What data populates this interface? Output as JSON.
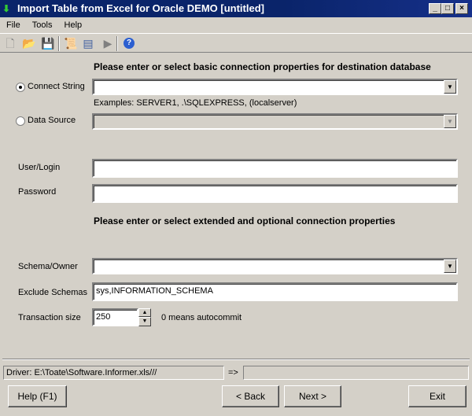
{
  "window": {
    "title": "Import Table from Excel for Oracle DEMO [untitled]"
  },
  "menu": [
    "File",
    "Tools",
    "Help"
  ],
  "toolbar": [
    "new-icon",
    "open-icon",
    "save-icon",
    "script-icon",
    "properties-icon",
    "run-icon",
    "help-icon"
  ],
  "section1": {
    "heading": "Please enter or select basic connection properties for destination database"
  },
  "connect_string": {
    "label": "Connect String",
    "value": "",
    "selected": true,
    "examples": "Examples: SERVER1, .\\SQLEXPRESS, (localserver)"
  },
  "data_source": {
    "label": "Data Source",
    "value": "",
    "selected": false
  },
  "user": {
    "label": "User/Login",
    "value": ""
  },
  "password": {
    "label": "Password",
    "value": ""
  },
  "section2": {
    "heading": "Please enter or select extended and optional connection properties"
  },
  "schema": {
    "label": "Schema/Owner",
    "value": ""
  },
  "exclude": {
    "label": "Exclude Schemas",
    "value": "sys,INFORMATION_SCHEMA"
  },
  "transaction": {
    "label": "Transaction size",
    "value": "250",
    "hint": "0 means autocommit"
  },
  "status": {
    "driver": "Driver: E:\\Toate\\Software.Informer.xls///",
    "arrow": "=>",
    "target": ""
  },
  "buttons": {
    "help": "Help (F1)",
    "back": "< Back",
    "next": "Next >",
    "exit": "Exit"
  }
}
